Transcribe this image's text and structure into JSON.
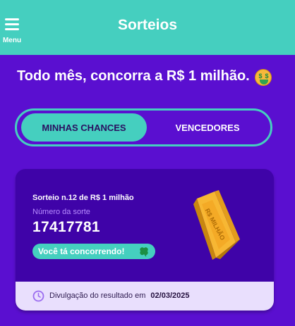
{
  "header": {
    "title": "Sorteios",
    "menu_label": "Menu",
    "background": "#45cfbf"
  },
  "headline": "Todo mês, concorra a R$ 1 milhão.",
  "headline_emoji": "money-mouth-face-icon",
  "tabs": [
    {
      "label": "MINHAS CHANCES",
      "active": true
    },
    {
      "label": "VENCEDORES",
      "active": false
    }
  ],
  "card": {
    "draw_title": "Sorteio n.12 de R$ 1 milhão",
    "lucky_label": "Número da sorte",
    "lucky_number": "17417781",
    "status": "Você tá concorrendo!",
    "status_icon": "clover-icon",
    "image": "gold-bar-icon",
    "image_text": "R$ MILHÃO",
    "footer_label": "Divulgação do resultado em",
    "footer_date": "02/03/2025",
    "footer_icon": "clock-icon"
  },
  "colors": {
    "background": "#5a0fd0",
    "accent": "#45cfbf",
    "card": "#3f03a8",
    "card_footer": "#e9dffd",
    "lucky_label": "#b78cff"
  }
}
